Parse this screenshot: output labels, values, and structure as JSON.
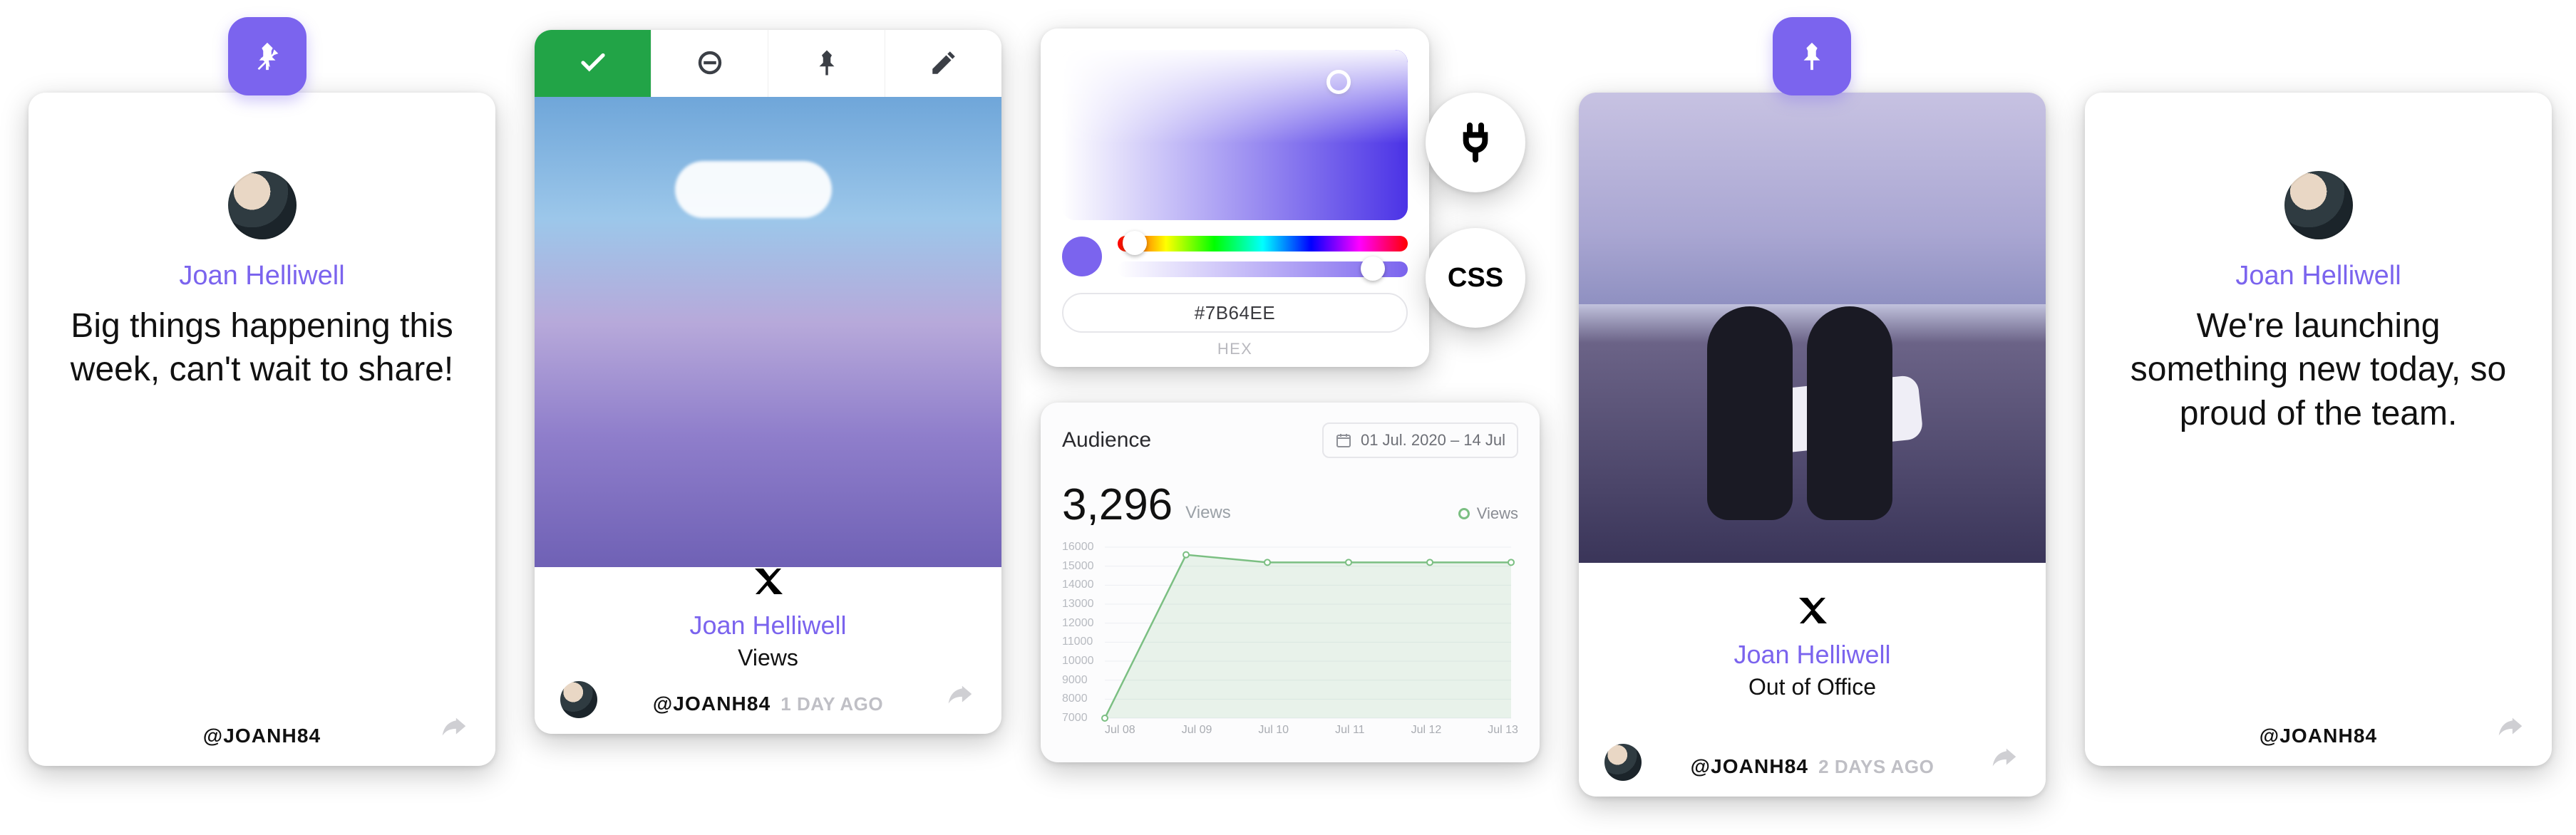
{
  "colors": {
    "accent": "#7B64EE",
    "approve_green": "#22A447"
  },
  "author": {
    "name": "Joan Helliwell",
    "handle": "@JOANH84"
  },
  "card1": {
    "message": "Big things happening this week, can't wait to share!"
  },
  "card2": {
    "platform_icon": "x-icon",
    "sub": "Views",
    "timestamp": "1 DAY AGO",
    "image_alt": "lavender field under blue sky"
  },
  "colorpicker": {
    "hex_value": "#7B64EE",
    "hex_label": "HEX",
    "hue_thumb_pct": 6,
    "sat_thumb_pct": 88
  },
  "tools": {
    "plug_label": "Connectors",
    "css_label": "CSS"
  },
  "analytics": {
    "title": "Audience",
    "date_range": "01 Jul. 2020 – 14 Jul",
    "metric_value": "3,296",
    "metric_label": "Views",
    "legend": "Views"
  },
  "chart_data": {
    "type": "line",
    "title": "Audience",
    "x": [
      "Jul 08",
      "Jul 09",
      "Jul 10",
      "Jul 11",
      "Jul 12",
      "Jul 13"
    ],
    "series": [
      {
        "name": "Views",
        "values": [
          7000,
          15600,
          15200,
          15200,
          15200,
          15200
        ]
      }
    ],
    "ylabel": "",
    "xlabel": "",
    "ylim": [
      7000,
      16000
    ],
    "y_ticks": [
      7000,
      8000,
      9000,
      10000,
      11000,
      12000,
      13000,
      14000,
      15000,
      16000
    ],
    "grid": true,
    "legend_position": "top-right"
  },
  "card3": {
    "platform_icon": "x-icon",
    "sub": "Out of Office",
    "timestamp": "2 DAYS AGO",
    "image_alt": "two surfers walking on beach carrying surfboard"
  },
  "card4": {
    "message": "We're launching something new today, so proud of the team."
  }
}
